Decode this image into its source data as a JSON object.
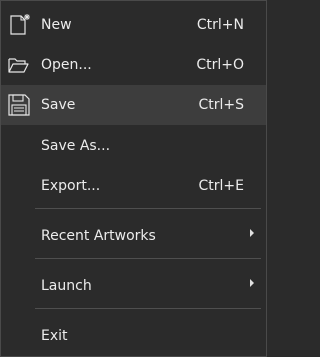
{
  "menu": {
    "new": {
      "label": "New",
      "shortcut": "Ctrl+N",
      "icon": "new-file-icon"
    },
    "open": {
      "label": "Open...",
      "shortcut": "Ctrl+O",
      "icon": "open-folder-icon"
    },
    "save": {
      "label": "Save",
      "shortcut": "Ctrl+S",
      "icon": "floppy-disk-icon",
      "highlighted": true
    },
    "save_as": {
      "label": "Save As..."
    },
    "export": {
      "label": "Export...",
      "shortcut": "Ctrl+E"
    },
    "recent": {
      "label": "Recent Artworks",
      "has_submenu": true
    },
    "launch": {
      "label": "Launch",
      "has_submenu": true
    },
    "exit": {
      "label": "Exit"
    }
  },
  "colors": {
    "background": "#2b2b2b",
    "highlight": "#3d3d3d",
    "text": "#ececec",
    "separator": "#4f4f4f",
    "border": "#4a4a4a"
  }
}
